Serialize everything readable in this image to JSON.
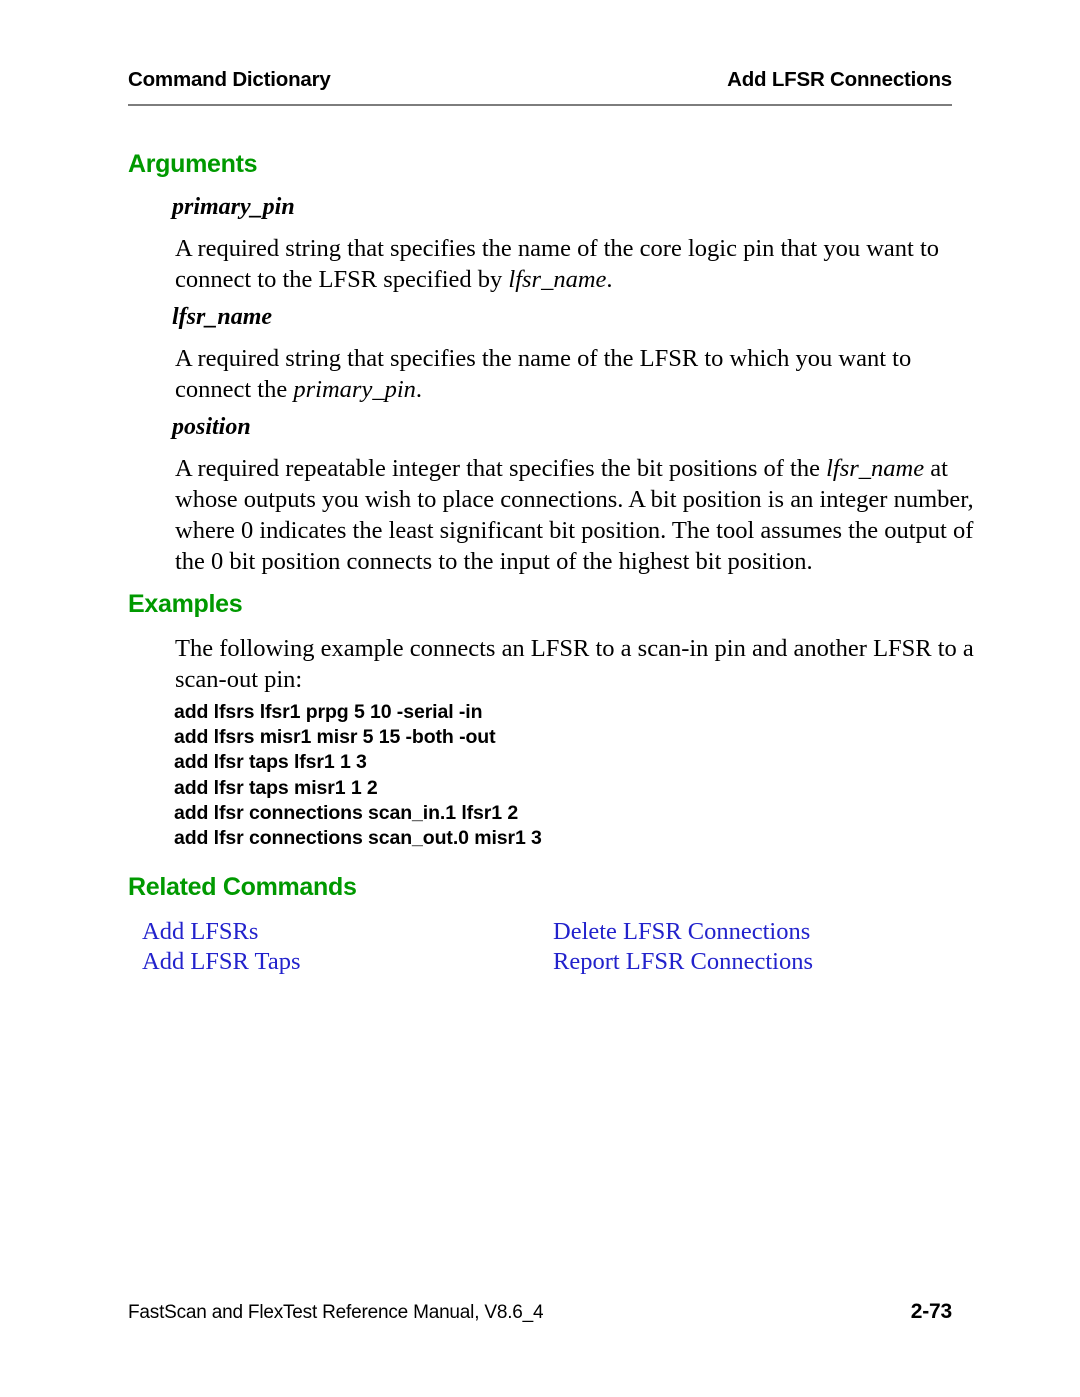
{
  "header": {
    "left": "Command Dictionary",
    "right": "Add LFSR Connections"
  },
  "sections": {
    "arguments_heading": "Arguments",
    "examples_heading": "Examples",
    "related_heading": "Related Commands"
  },
  "arguments": [
    {
      "term": "primary_pin",
      "description_part1": "A required string that specifies the name of the core logic pin that you want to connect to the LFSR specified by ",
      "description_italic": "lfsr_name",
      "description_part2": "."
    },
    {
      "term": "lfsr_name",
      "description_part1": "A required string that specifies the name of the LFSR to which you want to connect the ",
      "description_italic": "primary_pin",
      "description_part2": "."
    },
    {
      "term": "position",
      "description_part1": "A required repeatable integer that specifies the bit positions of the ",
      "description_italic": "lfsr_name",
      "description_part2": " at whose outputs you wish to place connections. A bit position is an integer number, where 0 indicates the least significant bit position. The tool assumes the output of the 0 bit position connects to the input of the highest bit position."
    }
  ],
  "examples": {
    "intro": "The following example connects an LFSR to a scan-in pin and another LFSR to a scan-out pin:",
    "code_lines": [
      "add lfsrs lfsr1 prpg 5 10 -serial -in",
      "add lfsrs misr1 misr 5 15 -both -out",
      "add lfsr taps lfsr1 1 3",
      "add lfsr taps misr1 1 2",
      "add lfsr connections scan_in.1 lfsr1 2",
      "add lfsr connections scan_out.0 misr1 3"
    ]
  },
  "related_commands": [
    {
      "left": "Add LFSRs",
      "right": "Delete LFSR Connections"
    },
    {
      "left": "Add LFSR Taps",
      "right": "Report LFSR Connections"
    }
  ],
  "footer": {
    "manual": "FastScan and FlexTest Reference Manual, V8.6_4",
    "page": "2-73"
  },
  "colors": {
    "heading_green": "#009900",
    "link_blue": "#2222cc",
    "rule_gray": "#7d7d7d",
    "text_black": "#000000"
  }
}
